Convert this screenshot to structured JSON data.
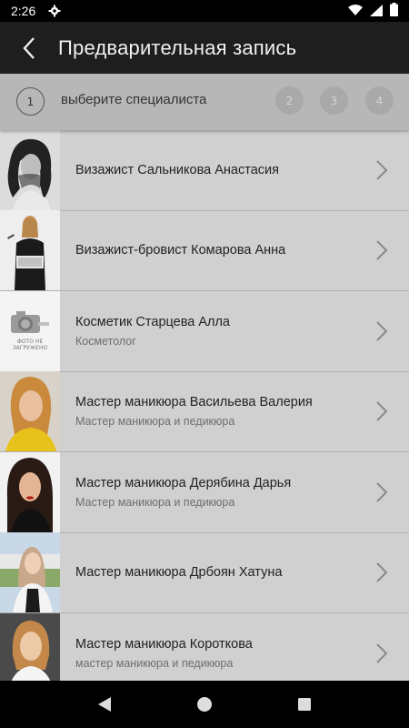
{
  "status_bar": {
    "time": "2:26",
    "icons": [
      "gear-icon",
      "wifi-icon",
      "signal-icon",
      "battery-icon"
    ]
  },
  "app_bar": {
    "title": "Предварительная запись",
    "back_icon": "chevron-left-icon"
  },
  "steps": {
    "current": "1",
    "label": "выберите специалиста",
    "upcoming": [
      "2",
      "3",
      "4"
    ]
  },
  "specialists": [
    {
      "name": "Визажист Сальникова Анастасия",
      "subtitle": "",
      "photo": "photo-bw-woman"
    },
    {
      "name": "Визажист-бровист Комарова Анна",
      "subtitle": "",
      "photo": "photo-woman-black-outfit"
    },
    {
      "name": "Косметик Старцева Алла",
      "subtitle": "Косметолог",
      "photo": "no-photo",
      "placeholder_text": "ФОТО НЕ ЗАГРУЖЕНО"
    },
    {
      "name": "Мастер маникюра Васильева Валерия",
      "subtitle": "Мастер маникюра и педикюра",
      "photo": "photo-woman-yellow"
    },
    {
      "name": "Мастер маникюра Дерябина Дарья",
      "subtitle": "Мастер маникюра и педикюра",
      "photo": "photo-woman-dark"
    },
    {
      "name": "Мастер маникюра Дрбоян Хатуна",
      "subtitle": "",
      "photo": "photo-woman-outdoor"
    },
    {
      "name": "Мастер маникюра Короткова",
      "subtitle": "мастер маникюра и педикюра",
      "photo": "photo-woman-white"
    }
  ],
  "nav_bar": {
    "buttons": [
      "back-triangle-icon",
      "home-circle-icon",
      "recents-square-icon"
    ]
  },
  "colors": {
    "app_bar": "#1e1e1e",
    "steps_bar": "#b7b7b7",
    "list_bg": "#d0d0d0"
  }
}
